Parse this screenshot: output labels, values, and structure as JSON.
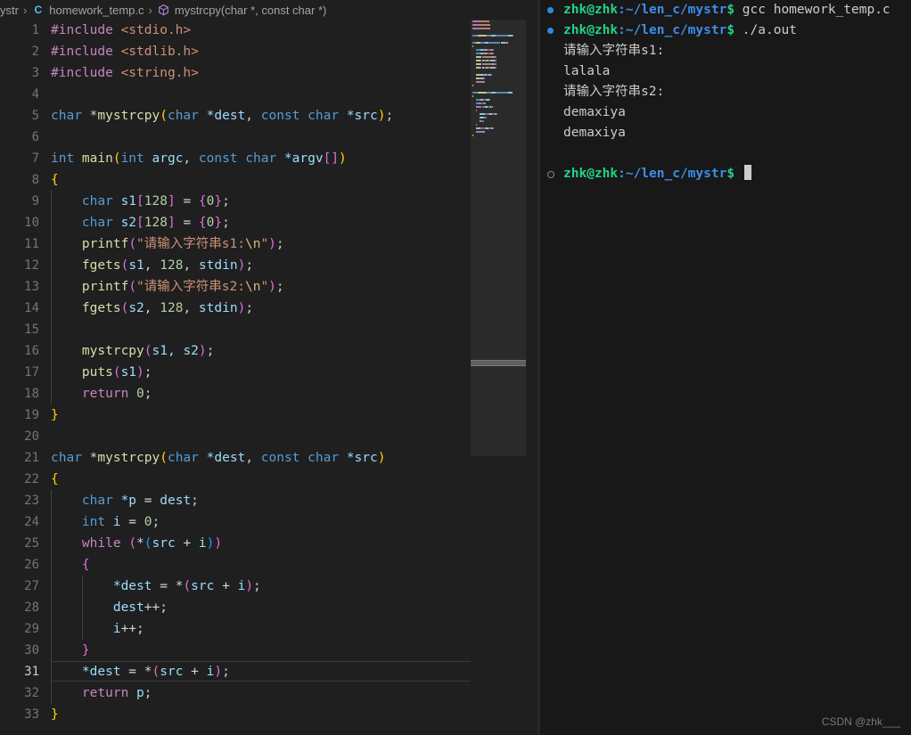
{
  "breadcrumb": {
    "items": [
      {
        "label": "ystr",
        "icon": null
      },
      {
        "label": "homework_temp.c",
        "icon": "c-file-icon"
      },
      {
        "label": "mystrcpy(char *, const char *)",
        "icon": "symbol-method-icon"
      }
    ],
    "separator": "›"
  },
  "editor": {
    "active_line": 31,
    "lines": [
      {
        "n": 1,
        "indent": 0,
        "tokens": [
          {
            "t": "#include ",
            "c": "t-pp"
          },
          {
            "t": "<stdio.h>",
            "c": "t-str"
          }
        ]
      },
      {
        "n": 2,
        "indent": 0,
        "tokens": [
          {
            "t": "#include ",
            "c": "t-pp"
          },
          {
            "t": "<stdlib.h>",
            "c": "t-str"
          }
        ]
      },
      {
        "n": 3,
        "indent": 0,
        "tokens": [
          {
            "t": "#include ",
            "c": "t-pp"
          },
          {
            "t": "<string.h>",
            "c": "t-str"
          }
        ]
      },
      {
        "n": 4,
        "indent": 0,
        "tokens": []
      },
      {
        "n": 5,
        "indent": 0,
        "tokens": [
          {
            "t": "char ",
            "c": "t-type"
          },
          {
            "t": "*",
            "c": "t-op"
          },
          {
            "t": "mystrcpy",
            "c": "t-fn"
          },
          {
            "t": "(",
            "c": "t-b1"
          },
          {
            "t": "char ",
            "c": "t-type"
          },
          {
            "t": "*dest",
            "c": "t-var"
          },
          {
            "t": ", ",
            "c": "t-plain"
          },
          {
            "t": "const char ",
            "c": "t-type"
          },
          {
            "t": "*src",
            "c": "t-var"
          },
          {
            "t": ")",
            "c": "t-b1"
          },
          {
            "t": ";",
            "c": "t-plain"
          }
        ]
      },
      {
        "n": 6,
        "indent": 0,
        "tokens": []
      },
      {
        "n": 7,
        "indent": 0,
        "tokens": [
          {
            "t": "int ",
            "c": "t-type"
          },
          {
            "t": "main",
            "c": "t-fn"
          },
          {
            "t": "(",
            "c": "t-b1"
          },
          {
            "t": "int ",
            "c": "t-type"
          },
          {
            "t": "argc",
            "c": "t-var"
          },
          {
            "t": ", ",
            "c": "t-plain"
          },
          {
            "t": "const char ",
            "c": "t-type"
          },
          {
            "t": "*argv",
            "c": "t-var"
          },
          {
            "t": "[",
            "c": "t-b2"
          },
          {
            "t": "]",
            "c": "t-b2"
          },
          {
            "t": ")",
            "c": "t-b1"
          }
        ]
      },
      {
        "n": 8,
        "indent": 0,
        "tokens": [
          {
            "t": "{",
            "c": "t-b1"
          }
        ]
      },
      {
        "n": 9,
        "indent": 1,
        "tokens": [
          {
            "t": "    ",
            "c": "t-plain"
          },
          {
            "t": "char ",
            "c": "t-type"
          },
          {
            "t": "s1",
            "c": "t-var"
          },
          {
            "t": "[",
            "c": "t-b2"
          },
          {
            "t": "128",
            "c": "t-num"
          },
          {
            "t": "]",
            "c": "t-b2"
          },
          {
            "t": " = ",
            "c": "t-op"
          },
          {
            "t": "{",
            "c": "t-b2"
          },
          {
            "t": "0",
            "c": "t-num"
          },
          {
            "t": "}",
            "c": "t-b2"
          },
          {
            "t": ";",
            "c": "t-plain"
          }
        ]
      },
      {
        "n": 10,
        "indent": 1,
        "tokens": [
          {
            "t": "    ",
            "c": "t-plain"
          },
          {
            "t": "char ",
            "c": "t-type"
          },
          {
            "t": "s2",
            "c": "t-var"
          },
          {
            "t": "[",
            "c": "t-b2"
          },
          {
            "t": "128",
            "c": "t-num"
          },
          {
            "t": "]",
            "c": "t-b2"
          },
          {
            "t": " = ",
            "c": "t-op"
          },
          {
            "t": "{",
            "c": "t-b2"
          },
          {
            "t": "0",
            "c": "t-num"
          },
          {
            "t": "}",
            "c": "t-b2"
          },
          {
            "t": ";",
            "c": "t-plain"
          }
        ]
      },
      {
        "n": 11,
        "indent": 1,
        "tokens": [
          {
            "t": "    ",
            "c": "t-plain"
          },
          {
            "t": "printf",
            "c": "t-fn"
          },
          {
            "t": "(",
            "c": "t-b2"
          },
          {
            "t": "\"请输入字符串s1:",
            "c": "t-str"
          },
          {
            "t": "\\n",
            "c": "t-esc"
          },
          {
            "t": "\"",
            "c": "t-str"
          },
          {
            "t": ")",
            "c": "t-b2"
          },
          {
            "t": ";",
            "c": "t-plain"
          }
        ]
      },
      {
        "n": 12,
        "indent": 1,
        "tokens": [
          {
            "t": "    ",
            "c": "t-plain"
          },
          {
            "t": "fgets",
            "c": "t-fn"
          },
          {
            "t": "(",
            "c": "t-b2"
          },
          {
            "t": "s1",
            "c": "t-var"
          },
          {
            "t": ", ",
            "c": "t-plain"
          },
          {
            "t": "128",
            "c": "t-num"
          },
          {
            "t": ", ",
            "c": "t-plain"
          },
          {
            "t": "stdin",
            "c": "t-var"
          },
          {
            "t": ")",
            "c": "t-b2"
          },
          {
            "t": ";",
            "c": "t-plain"
          }
        ]
      },
      {
        "n": 13,
        "indent": 1,
        "tokens": [
          {
            "t": "    ",
            "c": "t-plain"
          },
          {
            "t": "printf",
            "c": "t-fn"
          },
          {
            "t": "(",
            "c": "t-b2"
          },
          {
            "t": "\"请输入字符串s2:",
            "c": "t-str"
          },
          {
            "t": "\\n",
            "c": "t-esc"
          },
          {
            "t": "\"",
            "c": "t-str"
          },
          {
            "t": ")",
            "c": "t-b2"
          },
          {
            "t": ";",
            "c": "t-plain"
          }
        ]
      },
      {
        "n": 14,
        "indent": 1,
        "tokens": [
          {
            "t": "    ",
            "c": "t-plain"
          },
          {
            "t": "fgets",
            "c": "t-fn"
          },
          {
            "t": "(",
            "c": "t-b2"
          },
          {
            "t": "s2",
            "c": "t-var"
          },
          {
            "t": ", ",
            "c": "t-plain"
          },
          {
            "t": "128",
            "c": "t-num"
          },
          {
            "t": ", ",
            "c": "t-plain"
          },
          {
            "t": "stdin",
            "c": "t-var"
          },
          {
            "t": ")",
            "c": "t-b2"
          },
          {
            "t": ";",
            "c": "t-plain"
          }
        ]
      },
      {
        "n": 15,
        "indent": 1,
        "tokens": []
      },
      {
        "n": 16,
        "indent": 1,
        "tokens": [
          {
            "t": "    ",
            "c": "t-plain"
          },
          {
            "t": "mystrcpy",
            "c": "t-fn"
          },
          {
            "t": "(",
            "c": "t-b2"
          },
          {
            "t": "s1",
            "c": "t-var"
          },
          {
            "t": ", ",
            "c": "t-plain"
          },
          {
            "t": "s2",
            "c": "t-var"
          },
          {
            "t": ")",
            "c": "t-b2"
          },
          {
            "t": ";",
            "c": "t-plain"
          }
        ]
      },
      {
        "n": 17,
        "indent": 1,
        "tokens": [
          {
            "t": "    ",
            "c": "t-plain"
          },
          {
            "t": "puts",
            "c": "t-fn"
          },
          {
            "t": "(",
            "c": "t-b2"
          },
          {
            "t": "s1",
            "c": "t-var"
          },
          {
            "t": ")",
            "c": "t-b2"
          },
          {
            "t": ";",
            "c": "t-plain"
          }
        ]
      },
      {
        "n": 18,
        "indent": 1,
        "tokens": [
          {
            "t": "    ",
            "c": "t-plain"
          },
          {
            "t": "return ",
            "c": "t-key"
          },
          {
            "t": "0",
            "c": "t-num"
          },
          {
            "t": ";",
            "c": "t-plain"
          }
        ]
      },
      {
        "n": 19,
        "indent": 0,
        "tokens": [
          {
            "t": "}",
            "c": "t-b1"
          }
        ]
      },
      {
        "n": 20,
        "indent": 0,
        "tokens": []
      },
      {
        "n": 21,
        "indent": 0,
        "tokens": [
          {
            "t": "char ",
            "c": "t-type"
          },
          {
            "t": "*",
            "c": "t-op"
          },
          {
            "t": "mystrcpy",
            "c": "t-fn"
          },
          {
            "t": "(",
            "c": "t-b1"
          },
          {
            "t": "char ",
            "c": "t-type"
          },
          {
            "t": "*dest",
            "c": "t-var"
          },
          {
            "t": ", ",
            "c": "t-plain"
          },
          {
            "t": "const char ",
            "c": "t-type"
          },
          {
            "t": "*src",
            "c": "t-var"
          },
          {
            "t": ")",
            "c": "t-b1"
          }
        ]
      },
      {
        "n": 22,
        "indent": 0,
        "tokens": [
          {
            "t": "{",
            "c": "t-b1"
          }
        ]
      },
      {
        "n": 23,
        "indent": 1,
        "tokens": [
          {
            "t": "    ",
            "c": "t-plain"
          },
          {
            "t": "char ",
            "c": "t-type"
          },
          {
            "t": "*p",
            "c": "t-var"
          },
          {
            "t": " = ",
            "c": "t-op"
          },
          {
            "t": "dest",
            "c": "t-var"
          },
          {
            "t": ";",
            "c": "t-plain"
          }
        ]
      },
      {
        "n": 24,
        "indent": 1,
        "tokens": [
          {
            "t": "    ",
            "c": "t-plain"
          },
          {
            "t": "int ",
            "c": "t-type"
          },
          {
            "t": "i",
            "c": "t-var"
          },
          {
            "t": " = ",
            "c": "t-op"
          },
          {
            "t": "0",
            "c": "t-num"
          },
          {
            "t": ";",
            "c": "t-plain"
          }
        ]
      },
      {
        "n": 25,
        "indent": 1,
        "tokens": [
          {
            "t": "    ",
            "c": "t-plain"
          },
          {
            "t": "while ",
            "c": "t-key"
          },
          {
            "t": "(",
            "c": "t-b2"
          },
          {
            "t": "*",
            "c": "t-op"
          },
          {
            "t": "(",
            "c": "t-b3"
          },
          {
            "t": "src",
            "c": "t-var"
          },
          {
            "t": " + ",
            "c": "t-op"
          },
          {
            "t": "i",
            "c": "t-var"
          },
          {
            "t": ")",
            "c": "t-b3"
          },
          {
            "t": ")",
            "c": "t-b2"
          }
        ]
      },
      {
        "n": 26,
        "indent": 1,
        "tokens": [
          {
            "t": "    ",
            "c": "t-plain"
          },
          {
            "t": "{",
            "c": "t-b2"
          }
        ]
      },
      {
        "n": 27,
        "indent": 2,
        "tokens": [
          {
            "t": "        ",
            "c": "t-plain"
          },
          {
            "t": "*dest",
            "c": "t-var"
          },
          {
            "t": " = ",
            "c": "t-op"
          },
          {
            "t": "*",
            "c": "t-op"
          },
          {
            "t": "(",
            "c": "t-b2"
          },
          {
            "t": "src",
            "c": "t-var"
          },
          {
            "t": " + ",
            "c": "t-op"
          },
          {
            "t": "i",
            "c": "t-var"
          },
          {
            "t": ")",
            "c": "t-b2"
          },
          {
            "t": ";",
            "c": "t-plain"
          }
        ]
      },
      {
        "n": 28,
        "indent": 2,
        "tokens": [
          {
            "t": "        ",
            "c": "t-plain"
          },
          {
            "t": "dest",
            "c": "t-var"
          },
          {
            "t": "++;",
            "c": "t-op"
          }
        ]
      },
      {
        "n": 29,
        "indent": 2,
        "tokens": [
          {
            "t": "        ",
            "c": "t-plain"
          },
          {
            "t": "i",
            "c": "t-var"
          },
          {
            "t": "++;",
            "c": "t-op"
          }
        ]
      },
      {
        "n": 30,
        "indent": 1,
        "tokens": [
          {
            "t": "    ",
            "c": "t-plain"
          },
          {
            "t": "}",
            "c": "t-b2"
          }
        ]
      },
      {
        "n": 31,
        "indent": 1,
        "tokens": [
          {
            "t": "    ",
            "c": "t-plain"
          },
          {
            "t": "*dest",
            "c": "t-var"
          },
          {
            "t": " = ",
            "c": "t-op"
          },
          {
            "t": "*",
            "c": "t-op"
          },
          {
            "t": "(",
            "c": "t-b2"
          },
          {
            "t": "src",
            "c": "t-var"
          },
          {
            "t": " + ",
            "c": "t-op"
          },
          {
            "t": "i",
            "c": "t-var"
          },
          {
            "t": ")",
            "c": "t-b2"
          },
          {
            "t": ";",
            "c": "t-plain"
          }
        ]
      },
      {
        "n": 32,
        "indent": 1,
        "tokens": [
          {
            "t": "    ",
            "c": "t-plain"
          },
          {
            "t": "return ",
            "c": "t-key"
          },
          {
            "t": "p",
            "c": "t-var"
          },
          {
            "t": ";",
            "c": "t-plain"
          }
        ]
      },
      {
        "n": 33,
        "indent": 0,
        "tokens": [
          {
            "t": "}",
            "c": "t-b1"
          }
        ]
      }
    ]
  },
  "terminal": {
    "lines": [
      {
        "marker": "success",
        "prompt": true,
        "user": "zhk@zhk",
        "path": ":~/len_c/mystr",
        "dollar": "$",
        "cmd": " gcc homework_temp.c"
      },
      {
        "marker": "success",
        "prompt": true,
        "user": "zhk@zhk",
        "path": ":~/len_c/mystr",
        "dollar": "$",
        "cmd": " ./a.out"
      },
      {
        "marker": null,
        "prompt": false,
        "text": "请输入字符串s1:"
      },
      {
        "marker": null,
        "prompt": false,
        "text": "lalala"
      },
      {
        "marker": null,
        "prompt": false,
        "text": "请输入字符串s2:"
      },
      {
        "marker": null,
        "prompt": false,
        "text": "demaxiya"
      },
      {
        "marker": null,
        "prompt": false,
        "text": "demaxiya"
      },
      {
        "marker": null,
        "prompt": false,
        "text": ""
      },
      {
        "marker": "idle",
        "prompt": true,
        "user": "zhk@zhk",
        "path": ":~/len_c/mystr",
        "dollar": "$",
        "cmd": " ",
        "cursor": true
      }
    ]
  },
  "watermark": "CSDN @zhk___",
  "colors": {
    "editor_bg": "#1f1f1f",
    "terminal_bg": "#181818",
    "minimap_bg": "#2a2a2a",
    "prompt_user": "#23d18b",
    "prompt_path": "#3b8eea",
    "marker_success": "#2e8ad8"
  }
}
